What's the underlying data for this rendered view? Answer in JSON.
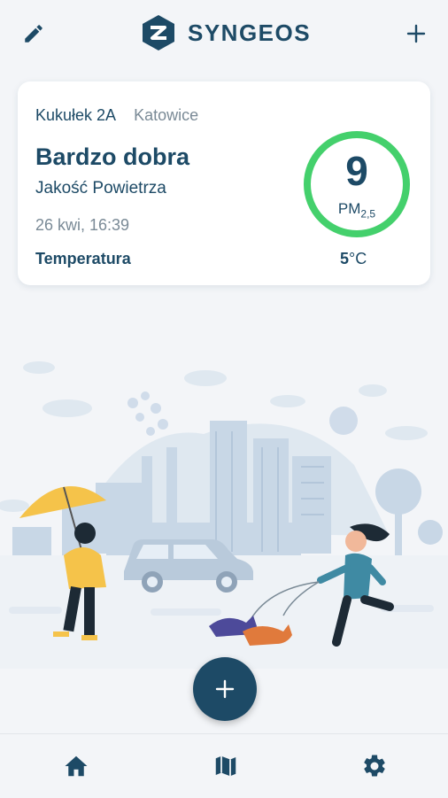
{
  "header": {
    "app_name": "SYNGEOS",
    "edit_icon": "pencil-icon",
    "add_icon": "plus-icon"
  },
  "station": {
    "street": "Kukułek 2A",
    "city": "Katowice",
    "quality": "Bardzo dobra",
    "quality_caption": "Jakość Powietrza",
    "datetime": "26 kwi, 16:39",
    "temperature_label": "Temperatura",
    "pm_value": "9",
    "pm_label": "PM",
    "pm_sub": "2,5",
    "temperature_value": "5",
    "temperature_unit": "°C"
  },
  "colors": {
    "primary": "#1d4a66",
    "good": "#44d06c",
    "background": "#f3f5f8"
  },
  "fab": {
    "icon": "plus-icon"
  },
  "nav": [
    {
      "icon": "home-icon",
      "active": true
    },
    {
      "icon": "map-icon",
      "active": false
    },
    {
      "icon": "gear-icon",
      "active": false
    }
  ]
}
